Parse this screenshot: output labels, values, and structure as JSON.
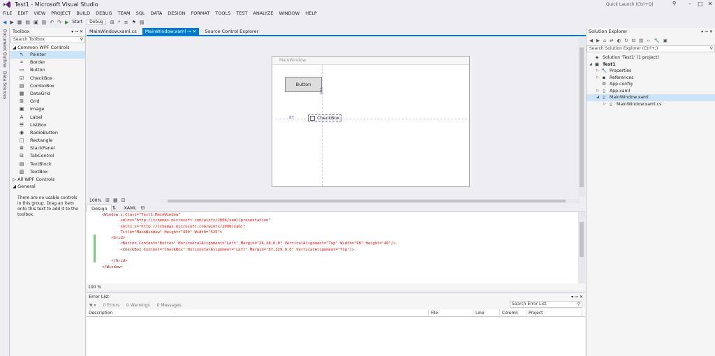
{
  "window": {
    "title": "Test1 - Microsoft Visual Studio",
    "quick_launch_placeholder": "Quick Launch (Ctrl+Q)"
  },
  "menu": [
    "FILE",
    "EDIT",
    "VIEW",
    "PROJECT",
    "BUILD",
    "DEBUG",
    "TEAM",
    "SQL",
    "DATA",
    "DESIGN",
    "FORMAT",
    "TOOLS",
    "TEST",
    "ANALYZE",
    "WINDOW",
    "HELP"
  ],
  "toolbar": {
    "start_label": "Start",
    "config_label": "Debug"
  },
  "left_rail": {
    "tabs": [
      "Document Outline",
      "Data Sources"
    ]
  },
  "toolbox": {
    "title": "Toolbox",
    "search_placeholder": "Search Toolbox",
    "group_common": "Common WPF Controls",
    "items": [
      {
        "label": "Pointer",
        "icon": "pointer-icon",
        "glyph": "↖"
      },
      {
        "label": "Border",
        "icon": "border-icon",
        "glyph": "⌗"
      },
      {
        "label": "Button",
        "icon": "button-icon",
        "glyph": "▭"
      },
      {
        "label": "CheckBox",
        "icon": "checkbox-icon",
        "glyph": "☑"
      },
      {
        "label": "ComboBox",
        "icon": "combobox-icon",
        "glyph": "▤"
      },
      {
        "label": "DataGrid",
        "icon": "datagrid-icon",
        "glyph": "▦"
      },
      {
        "label": "Grid",
        "icon": "grid-icon",
        "glyph": "⊞"
      },
      {
        "label": "Image",
        "icon": "image-icon",
        "glyph": "▣"
      },
      {
        "label": "Label",
        "icon": "label-icon",
        "glyph": "A"
      },
      {
        "label": "ListBox",
        "icon": "listbox-icon",
        "glyph": "☰"
      },
      {
        "label": "RadioButton",
        "icon": "radiobutton-icon",
        "glyph": "◉"
      },
      {
        "label": "Rectangle",
        "icon": "rectangle-icon",
        "glyph": "□"
      },
      {
        "label": "StackPanel",
        "icon": "stackpanel-icon",
        "glyph": "≣"
      },
      {
        "label": "TabControl",
        "icon": "tabcontrol-icon",
        "glyph": "⊟"
      },
      {
        "label": "TextBlock",
        "icon": "textblock-icon",
        "glyph": "▤"
      },
      {
        "label": "TextBox",
        "icon": "textbox-icon",
        "glyph": "▥"
      }
    ],
    "group_all": "All WPF Controls",
    "group_general": "General",
    "empty_message": "There are no usable controls in this group. Drag an item onto this text to add it to the toolbox."
  },
  "doc_tabs": [
    {
      "label": "MainWindow.xaml.cs",
      "active": false
    },
    {
      "label": "MainWindow.xaml",
      "active": true
    },
    {
      "label": "Source Control Explorer",
      "active": false
    }
  ],
  "designer": {
    "window_title": "MainWindow",
    "button_label": "Button",
    "checkbox_label": "CheckBox",
    "margin_left": "87",
    "margin_top": "129",
    "zoom": "100%"
  },
  "split_tabs": {
    "design": "Design",
    "xaml": "XAML"
  },
  "xaml": {
    "lines": [
      {
        "indent": "",
        "tag": "<Window",
        "rest": " x:Class=\"Test1.MainWindow\""
      },
      {
        "indent": "        ",
        "tag": "",
        "rest": "xmlns=\"http://schemas.microsoft.com/winfx/2006/xaml/presentation\""
      },
      {
        "indent": "        ",
        "tag": "",
        "rest": "xmlns:x=\"http://schemas.microsoft.com/winfx/2006/xaml\""
      },
      {
        "indent": "        ",
        "tag": "",
        "rest": "Title=\"MainWindow\" Height=\"350\" Width=\"525\">"
      },
      {
        "indent": "    ",
        "tag": "<Grid>",
        "rest": ""
      },
      {
        "indent": "        ",
        "tag": "<Button",
        "rest": " Content=\"Button\" HorizontalAlignment=\"Left\" Margin=\"26,28,0,0\" VerticalAlignment=\"Top\" Width=\"98\" Height=\"40\"/>"
      },
      {
        "indent": "        ",
        "tag": "<CheckBox",
        "rest": " Content=\"CheckBox\" HorizontalAlignment=\"Left\" Margin=\"87,129,0,0\" VerticalAlignment=\"Top\"/>"
      },
      {
        "indent": "",
        "tag": "",
        "rest": ""
      },
      {
        "indent": "    ",
        "tag": "</Grid>",
        "rest": ""
      },
      {
        "indent": "",
        "tag": "</Window>",
        "rest": ""
      }
    ],
    "zoom": "100 %"
  },
  "error_list": {
    "title": "Error List",
    "errors": "0 Errors",
    "warnings": "0 Warnings",
    "messages": "0 Messages",
    "search_placeholder": "Search Error List",
    "columns": [
      "Description",
      "File",
      "Line",
      "Column",
      "Project"
    ]
  },
  "solution_explorer": {
    "title": "Solution Explorer",
    "search_placeholder": "Search Solution Explorer (Ctrl+;)",
    "items": [
      {
        "label": "Solution 'Test1' (1 project)",
        "level": 0,
        "arrow": "",
        "icon": "solution-icon",
        "glyph": "◈",
        "bold": false,
        "selected": false
      },
      {
        "label": "Test1",
        "level": 0,
        "arrow": "◢",
        "icon": "project-icon",
        "glyph": "▣",
        "bold": true,
        "selected": false
      },
      {
        "label": "Properties",
        "level": 1,
        "arrow": "▷",
        "icon": "wrench-icon",
        "glyph": "🔧",
        "bold": false,
        "selected": false
      },
      {
        "label": "References",
        "level": 1,
        "arrow": "▷",
        "icon": "references-icon",
        "glyph": "▪",
        "bold": false,
        "selected": false
      },
      {
        "label": "App.config",
        "level": 1,
        "arrow": "",
        "icon": "config-file-icon",
        "glyph": "⚙",
        "bold": false,
        "selected": false
      },
      {
        "label": "App.xaml",
        "level": 1,
        "arrow": "▷",
        "icon": "xaml-file-icon",
        "glyph": "▯",
        "bold": false,
        "selected": false
      },
      {
        "label": "MainWindow.xaml",
        "level": 1,
        "arrow": "◢",
        "icon": "xaml-file-icon",
        "glyph": "▯",
        "bold": false,
        "selected": true
      },
      {
        "label": "MainWindow.xaml.cs",
        "level": 2,
        "arrow": "▷",
        "icon": "csharp-file-icon",
        "glyph": "▯",
        "bold": false,
        "selected": false
      }
    ]
  },
  "colors": {
    "accent": "#007acc",
    "background": "#eeeef2",
    "selection": "#cce4f7"
  }
}
